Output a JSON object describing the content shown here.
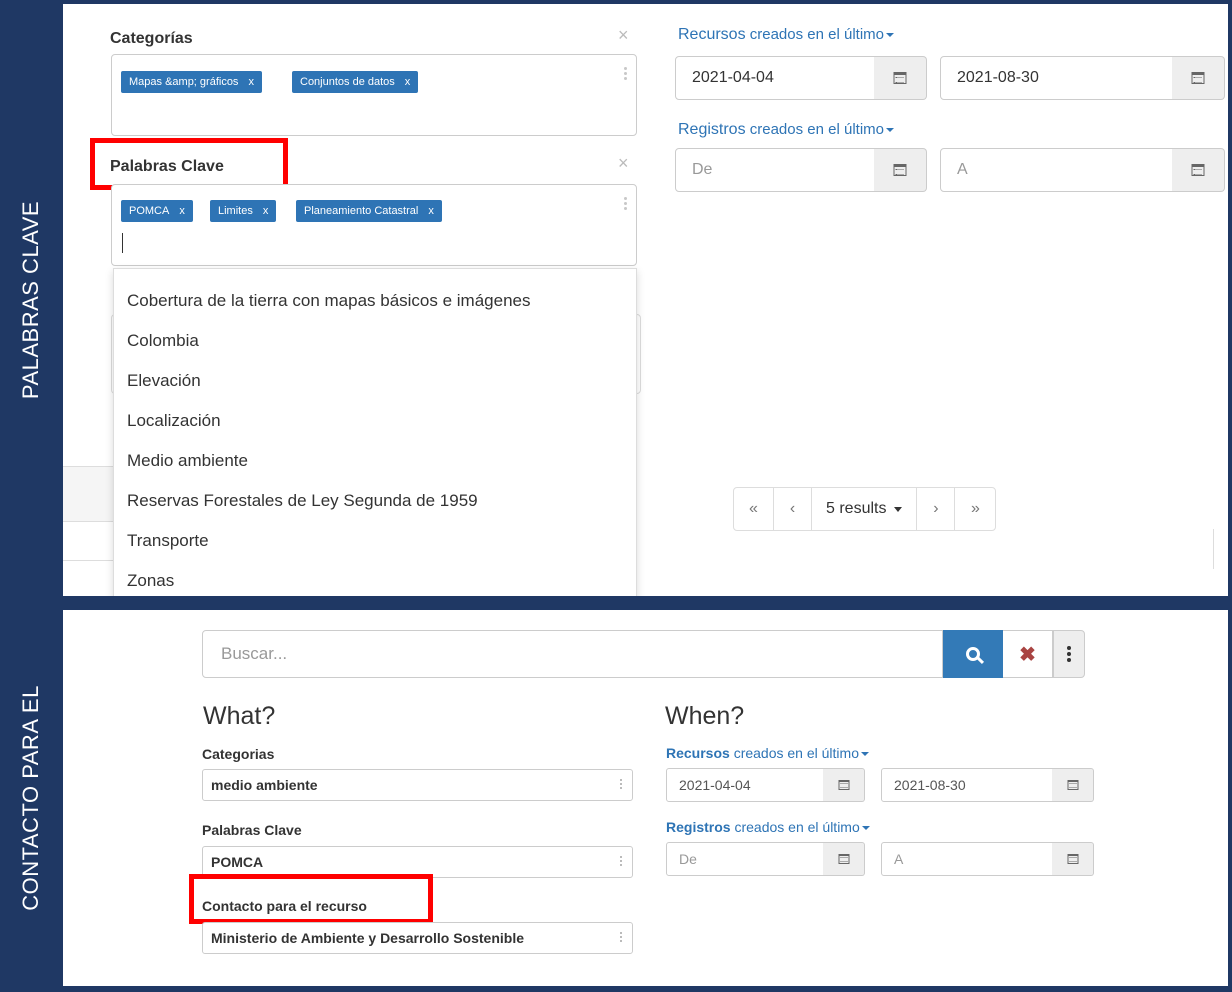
{
  "side_labels": {
    "top": "PALABRAS CLAVE",
    "bottom": "CONTACTO PARA EL"
  },
  "top_panel": {
    "categorias_label": "Categorías",
    "categorias_tags": [
      "Mapas &amp; gráficos",
      "Conjuntos de datos"
    ],
    "palabras_label": "Palabras Clave",
    "palabras_tags": [
      "POMCA",
      "Limites",
      "Planeamiento Catastral"
    ],
    "tag_remove": "x",
    "clear": "×",
    "dropdown_options": [
      "Cobertura de la tierra con mapas básicos e imágenes",
      "Colombia",
      "Elevación",
      "Localización",
      "Medio ambiente",
      "Reservas Forestales de Ley Segunda de 1959",
      "Transporte",
      "Zonas"
    ],
    "recursos_link": "Recursos",
    "recursos_rest": " creados en el último",
    "registros_link": "Registros",
    "registros_rest": " creados en el último",
    "recursos_from": "2021-04-04",
    "recursos_to": "2021-08-30",
    "registros_from_placeholder": "De",
    "registros_to_placeholder": "A",
    "pager": {
      "first": "«",
      "prev": "‹",
      "results": "5 results",
      "next": "›",
      "last": "»"
    }
  },
  "bottom_panel": {
    "search_placeholder": "Buscar...",
    "clear": "✖",
    "what": "What?",
    "when": "When?",
    "categorias_label": "Categorias",
    "categorias_value": "medio ambiente",
    "palabras_label": "Palabras Clave",
    "palabras_value": "POMCA",
    "contacto_label": "Contacto para el recurso",
    "contacto_value": "Ministerio de Ambiente y Desarrollo Sostenible",
    "recursos_link": "Recursos",
    "recursos_rest": " creados en el último",
    "registros_link": "Registros",
    "registros_rest": " creados en el último",
    "recursos_from": "2021-04-04",
    "recursos_to": "2021-08-30",
    "registros_from_placeholder": "De",
    "registros_to_placeholder": "A"
  },
  "colors": {
    "frame": "#1f3864",
    "accent": "#2e74b5",
    "highlight": "#ff0000"
  }
}
